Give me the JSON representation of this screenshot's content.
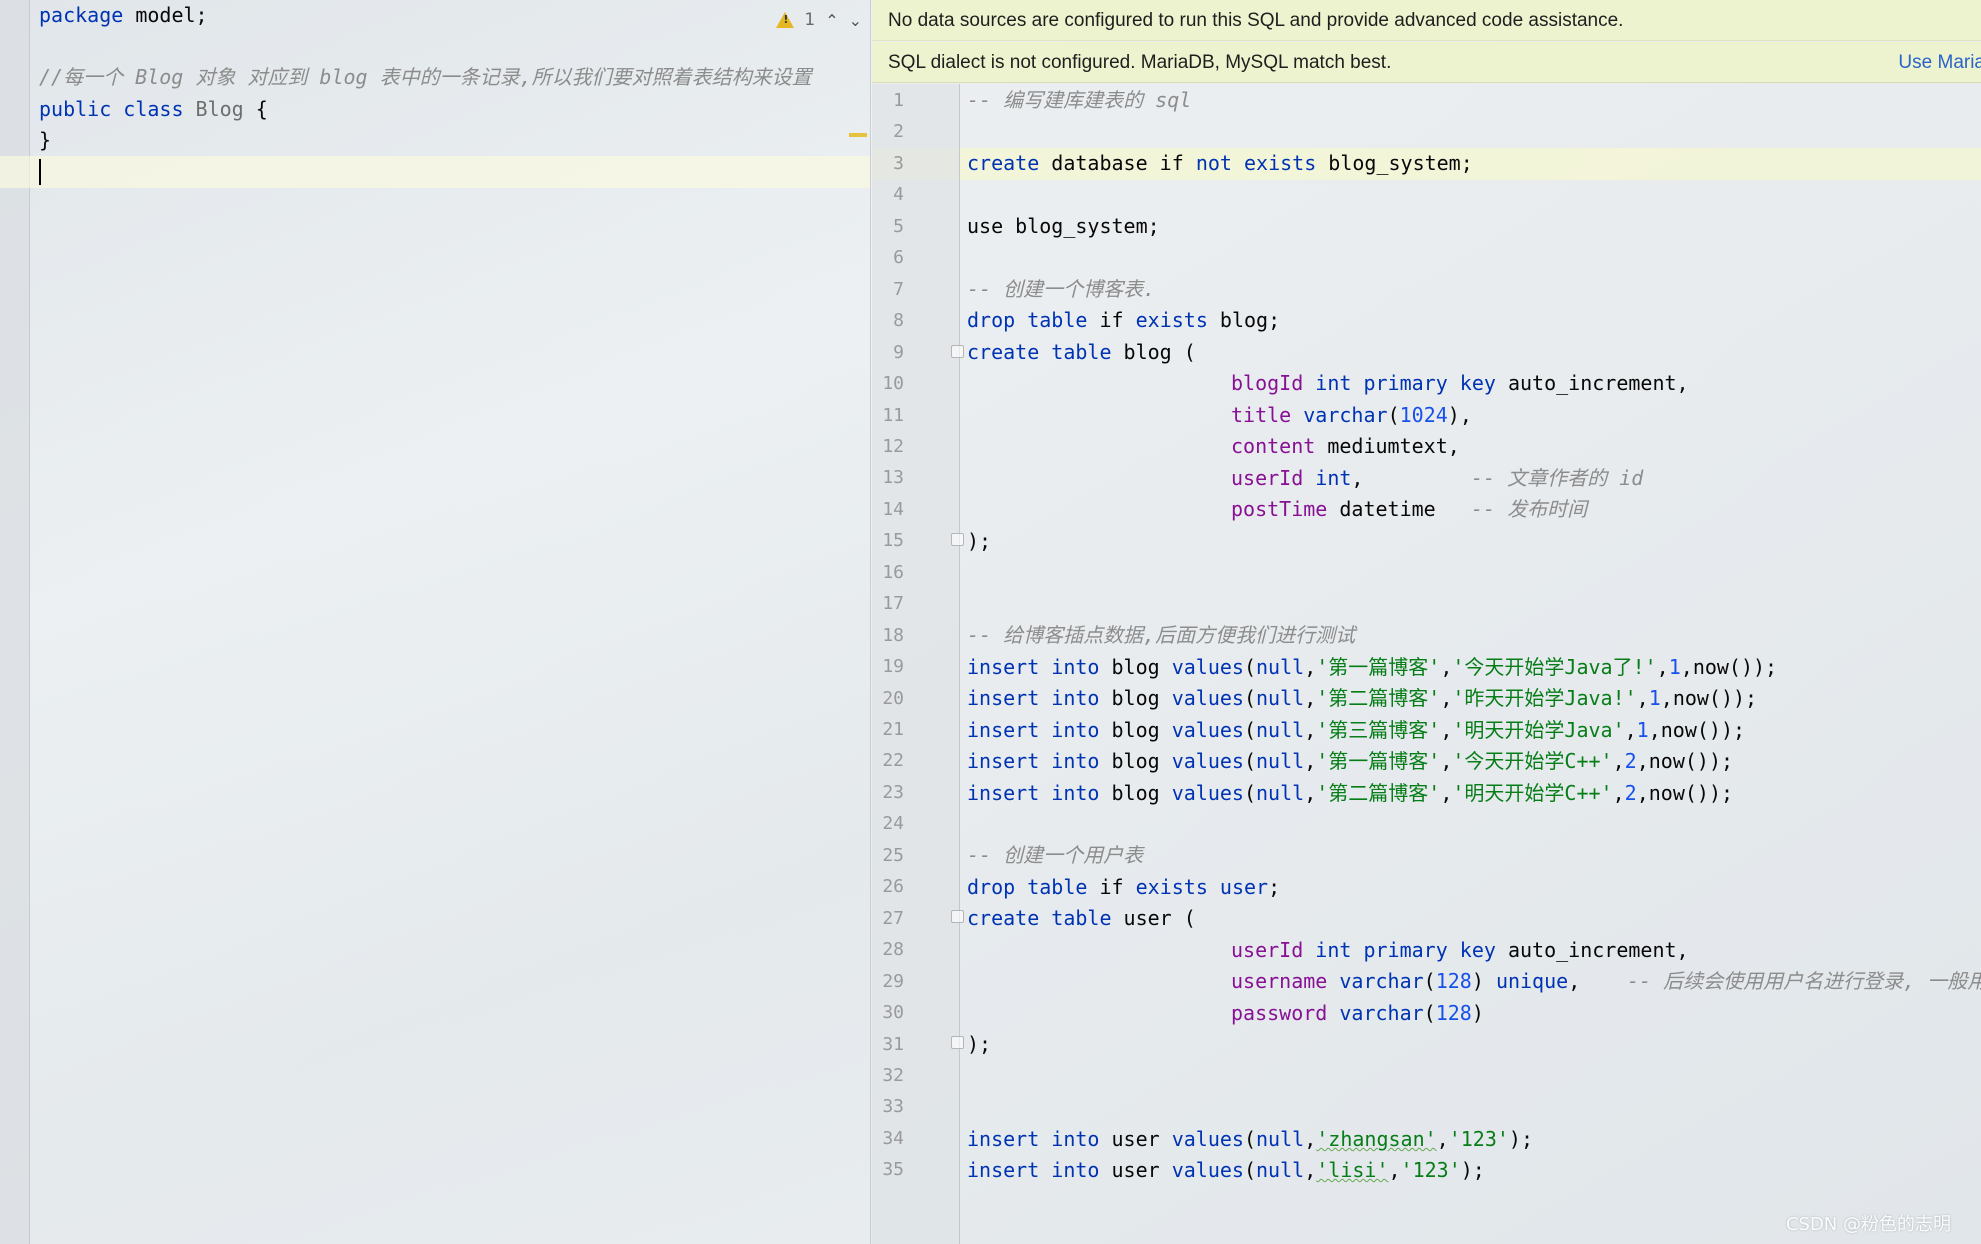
{
  "java_editor": {
    "lines": [
      {
        "t1": "package",
        "t2": " model;"
      },
      {
        "comment": "//每一个 Blog 对象 对应到 blog 表中的一条记录,所以我们要对照着表结构来设置"
      },
      {
        "t1": "public",
        "t2": " class",
        "t3": " Blog",
        "t4": " {"
      },
      {
        "t1": "}"
      }
    ],
    "warning_count": "1",
    "icons": [
      "warning-icon",
      "chevron-up-icon",
      "chevron-down-icon"
    ]
  },
  "sql_editor": {
    "banner_no_datasource": "No data sources are configured to run this SQL and provide advanced code assistance.",
    "banner_dialect": "SQL dialect is not configured. MariaDB, MySQL match best.",
    "banner_link": "Use Maria",
    "line_numbers": [
      "1",
      "2",
      "3",
      "4",
      "5",
      "6",
      "7",
      "8",
      "9",
      "10",
      "11",
      "12",
      "13",
      "14",
      "15",
      "16",
      "17",
      "18",
      "19",
      "20",
      "21",
      "22",
      "23",
      "24",
      "25",
      "26",
      "27",
      "28",
      "29",
      "30",
      "31",
      "32",
      "33",
      "34",
      "35"
    ],
    "code": {
      "l1": "-- 编写建库建表的 sql",
      "l3": {
        "a": "create",
        "b": " database ",
        "c": "if",
        "d": " ",
        "e": "not",
        "f": " ",
        "g": "exists",
        "h": " blog_system;"
      },
      "l5": "use blog_system;",
      "l7": "-- 创建一个博客表.",
      "l8": {
        "a": "drop",
        "b": " ",
        "c": "table",
        "d": " if ",
        "e": "exists",
        "f": " blog;"
      },
      "l9": {
        "a": "create",
        "b": " ",
        "c": "table",
        "d": " blog ("
      },
      "l10": {
        "col": "blogId",
        "sp": " ",
        "ty": "int",
        "k1": " primary key",
        "rest": " auto_increment,"
      },
      "l11": {
        "col": "title",
        "sp": " ",
        "ty": "varchar",
        "p1": "(",
        "n": "1024",
        "p2": "),"
      },
      "l12": {
        "col": "content",
        "rest": " mediumtext,"
      },
      "l13": {
        "col": "userId",
        "sp": " ",
        "ty": "int",
        "rest": ",",
        "cm": "-- 文章作者的 id"
      },
      "l14": {
        "col": "postTime",
        "rest": " datetime",
        "cm": "-- 发布时间"
      },
      "l15": ");",
      "l18": "-- 给博客插点数据,后面方便我们进行测试",
      "inserts_blog": [
        {
          "s1": "'第一篇博客'",
          "s2": "'今天开始学Java了!'",
          "n": "1"
        },
        {
          "s1": "'第二篇博客'",
          "s2": "'昨天开始学Java!'",
          "n": "1"
        },
        {
          "s1": "'第三篇博客'",
          "s2": "'明天开始学Java'",
          "n": "1"
        },
        {
          "s1": "'第一篇博客'",
          "s2": "'今天开始学C++'",
          "n": "2"
        },
        {
          "s1": "'第二篇博客'",
          "s2": "'明天开始学C++'",
          "n": "2"
        }
      ],
      "insert_parts": {
        "kw1": "insert",
        "kw2": " into",
        "tbl": " blog ",
        "fn": "values",
        "open": "(",
        "nul": "null",
        "comma": ",",
        "now": "now());"
      },
      "l25": "-- 创建一个用户表",
      "l26": {
        "a": "drop",
        "b": " ",
        "c": "table",
        "d": " if ",
        "e": "exists",
        "f": " ",
        "g": "user",
        "h": ";"
      },
      "l27": {
        "a": "create",
        "b": " ",
        "c": "table",
        "d": " user ("
      },
      "l28": {
        "col": "userId",
        "sp": " ",
        "ty": "int",
        "k1": " primary key",
        "rest": " auto_increment,"
      },
      "l29": {
        "col": "username",
        "sp": " ",
        "ty": "varchar",
        "p1": "(",
        "n": "128",
        "p2": ") ",
        "k1": "unique",
        "rest": ",",
        "cm": "-- 后续会使用用户名进行登录, 一般用"
      },
      "l30": {
        "col": "password",
        "sp": " ",
        "ty": "varchar",
        "p1": "(",
        "n": "128",
        "p2": ")"
      },
      "l31": ");",
      "l34": {
        "a": "insert",
        "b": " into",
        "c": " user ",
        "d": "values",
        "e": "(",
        "f": "null",
        "g": ",",
        "h": "'zhangsan'",
        "i": ",",
        "j": "'123'",
        "k": ");"
      },
      "l35": {
        "a": "insert",
        "b": " into",
        "c": " user ",
        "d": "values",
        "e": "(",
        "f": "null",
        "g": ",",
        "h": "'lisi'",
        "i": ",",
        "j": "'123'",
        "k": ");"
      }
    }
  },
  "watermark": "CSDN @粉色的志明",
  "colors": {
    "keyword": "#0033b3",
    "column": "#871094",
    "string": "#067d17",
    "number": "#1750eb",
    "comment": "#8c8c8c",
    "banner": "#eef3cf",
    "link": "#2a64c8"
  }
}
